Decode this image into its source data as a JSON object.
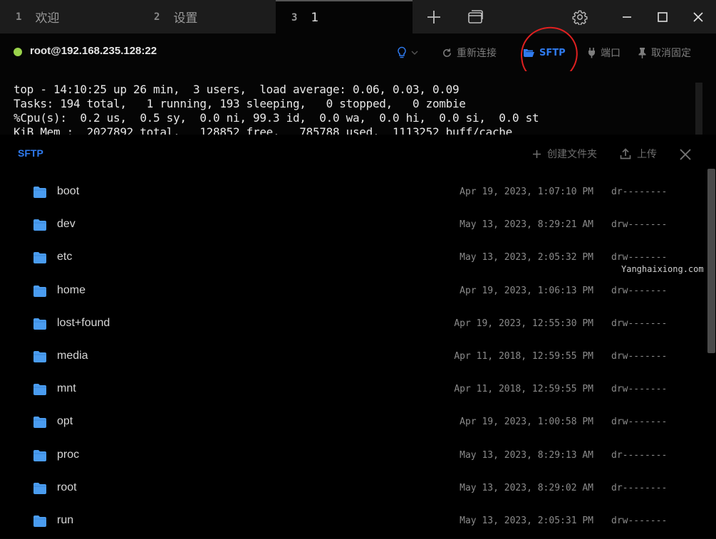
{
  "tabs": [
    {
      "num": "1",
      "label": "欢迎"
    },
    {
      "num": "2",
      "label": "设置"
    },
    {
      "num": "3",
      "label": "1"
    }
  ],
  "icons": {
    "new_tab": "plus-icon",
    "windows": "window-stack-icon",
    "settings": "gear-icon",
    "minimize": "minimize-icon",
    "maximize": "maximize-icon",
    "close": "close-icon"
  },
  "connection": {
    "status_color": "#9ad34b",
    "host": "root@192.168.235.128:22",
    "reconnect_label": "重新连接",
    "sftp_label": "SFTP",
    "port_label": "端口",
    "unpin_label": "取消固定"
  },
  "terminal": {
    "lines": [
      "top - 14:10:25 up 26 min,  3 users,  load average: 0.06, 0.03, 0.09",
      "Tasks: 194 total,   1 running, 193 sleeping,   0 stopped,   0 zombie",
      "%Cpu(s):  0.2 us,  0.5 sy,  0.0 ni, 99.3 id,  0.0 wa,  0.0 hi,  0.0 si,  0.0 st",
      "KiB Mem :  2027892 total,   128852 free,   785788 used,  1113252 buff/cache"
    ]
  },
  "sftp": {
    "title": "SFTP",
    "new_folder_label": "创建文件夹",
    "upload_label": "上传",
    "accent_color": "#2f7bf0",
    "files": [
      {
        "name": "boot",
        "date": "Apr 19, 2023, 1:07:10 PM",
        "perm": "dr--------"
      },
      {
        "name": "dev",
        "date": "May 13, 2023, 8:29:21 AM",
        "perm": "drw-------"
      },
      {
        "name": "etc",
        "date": "May 13, 2023, 2:05:32 PM",
        "perm": "drw-------"
      },
      {
        "name": "home",
        "date": "Apr 19, 2023, 1:06:13 PM",
        "perm": "drw-------"
      },
      {
        "name": "lost+found",
        "date": "Apr 19, 2023, 12:55:30 PM",
        "perm": "drw-------"
      },
      {
        "name": "media",
        "date": "Apr 11, 2018, 12:59:55 PM",
        "perm": "drw-------"
      },
      {
        "name": "mnt",
        "date": "Apr 11, 2018, 12:59:55 PM",
        "perm": "drw-------"
      },
      {
        "name": "opt",
        "date": "Apr 19, 2023, 1:00:58 PM",
        "perm": "drw-------"
      },
      {
        "name": "proc",
        "date": "May 13, 2023, 8:29:13 AM",
        "perm": "dr--------"
      },
      {
        "name": "root",
        "date": "May 13, 2023, 8:29:02 AM",
        "perm": "dr--------"
      },
      {
        "name": "run",
        "date": "May 13, 2023, 2:05:31 PM",
        "perm": "drw-------"
      }
    ]
  },
  "watermark": "Yanghaixiong.com"
}
